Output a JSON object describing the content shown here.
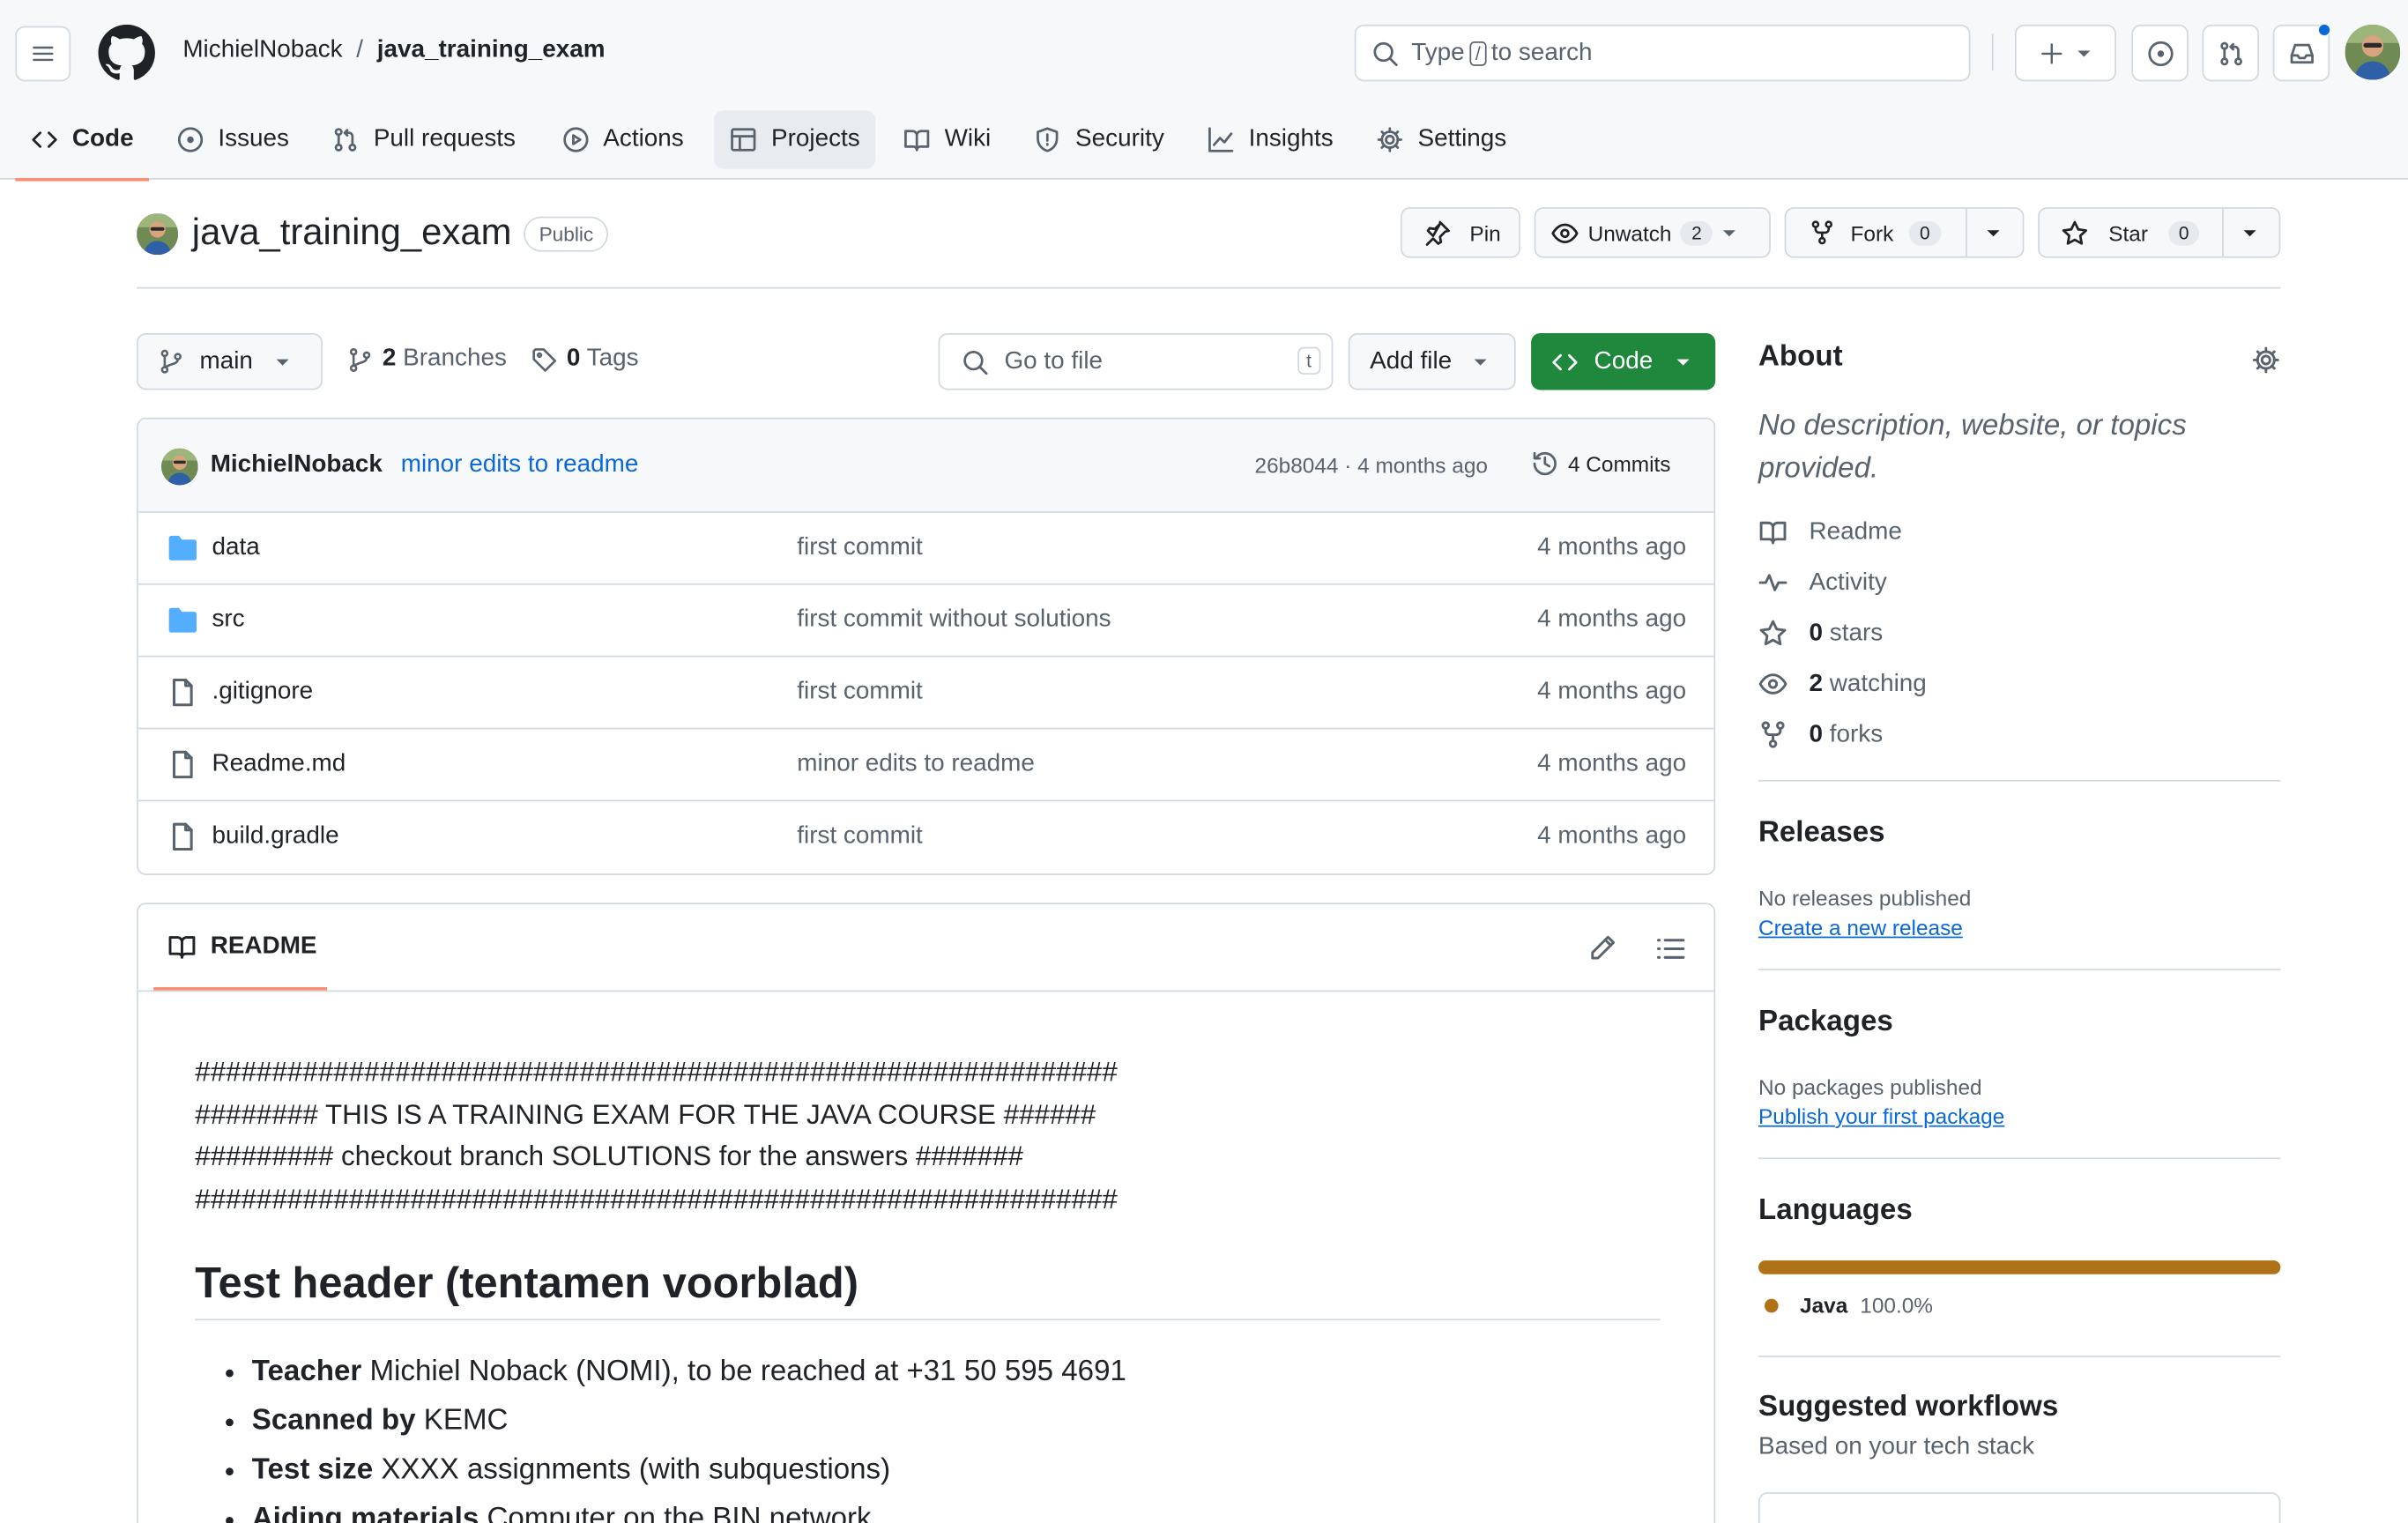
{
  "header": {
    "owner": "MichielNoback",
    "separator": "/",
    "repo": "java_training_exam",
    "search": {
      "prefix": "Type",
      "key": "/",
      "suffix": "to search"
    }
  },
  "tabs": [
    {
      "label": "Code",
      "icon": "code-icon"
    },
    {
      "label": "Issues",
      "icon": "issue-icon"
    },
    {
      "label": "Pull requests",
      "icon": "pull-request-icon"
    },
    {
      "label": "Actions",
      "icon": "play-icon"
    },
    {
      "label": "Projects",
      "icon": "table-icon"
    },
    {
      "label": "Wiki",
      "icon": "book-icon"
    },
    {
      "label": "Security",
      "icon": "shield-icon"
    },
    {
      "label": "Insights",
      "icon": "graph-icon"
    },
    {
      "label": "Settings",
      "icon": "gear-icon"
    }
  ],
  "repo_head": {
    "name": "java_training_exam",
    "visibility": "Public",
    "pin": "Pin",
    "unwatch": "Unwatch",
    "watch_count": "2",
    "fork": "Fork",
    "fork_count": "0",
    "star": "Star",
    "star_count": "0"
  },
  "file_nav": {
    "branch": "main",
    "branches_count": "2",
    "branches_label": "Branches",
    "tags_count": "0",
    "tags_label": "Tags",
    "goto_placeholder": "Go to file",
    "goto_key": "t",
    "add_file": "Add file",
    "code": "Code"
  },
  "latest_commit": {
    "author": "MichielNoback",
    "message": "minor edits to readme",
    "sha_age": "26b8044 · 4 months ago",
    "commits": "4 Commits"
  },
  "files": [
    {
      "name": "data",
      "type": "folder",
      "message": "first commit",
      "age": "4 months ago"
    },
    {
      "name": "src",
      "type": "folder",
      "message": "first commit without solutions",
      "age": "4 months ago"
    },
    {
      "name": ".gitignore",
      "type": "file",
      "message": "first commit",
      "age": "4 months ago"
    },
    {
      "name": "Readme.md",
      "type": "file",
      "message": "minor edits to readme",
      "age": "4 months ago"
    },
    {
      "name": "build.gradle",
      "type": "file",
      "message": "first commit",
      "age": "4 months ago"
    }
  ],
  "readme": {
    "tab": "README",
    "lines": [
      "############################################################",
      "######## THIS IS A TRAINING EXAM FOR THE JAVA COURSE ######",
      "######### checkout branch SOLUTIONS for the answers #######",
      "############################################################"
    ],
    "heading": "Test header (tentamen voorblad)",
    "items": [
      {
        "label": "Teacher",
        "text": "Michiel Noback (NOMI), to be reached at +31 50 595 4691"
      },
      {
        "label": "Scanned by",
        "text": "KEMC"
      },
      {
        "label": "Test size",
        "text": "XXXX assignments (with subquestions)"
      },
      {
        "label": "Aiding materials",
        "text": "Computer on the BIN network"
      }
    ]
  },
  "sidebar": {
    "about": "About",
    "description": "No description, website, or topics provided.",
    "readme": "Readme",
    "activity": "Activity",
    "stars_count": "0",
    "stars": "stars",
    "watching_count": "2",
    "watching": "watching",
    "forks_count": "0",
    "forks": "forks",
    "releases": "Releases",
    "no_releases": "No releases published",
    "create_release": "Create a new release",
    "packages": "Packages",
    "no_packages": "No packages published",
    "publish_package": "Publish your first package",
    "languages": "Languages",
    "lang_name": "Java",
    "lang_pct": "100.0%",
    "lang_color": "#b07219",
    "workflows": "Suggested workflows",
    "workflows_sub": "Based on your tech stack"
  },
  "colors": {
    "accent": "#0969da",
    "primary_button": "#1f883d",
    "tab_underline": "#fd8c73",
    "folder": "#54aeff"
  }
}
